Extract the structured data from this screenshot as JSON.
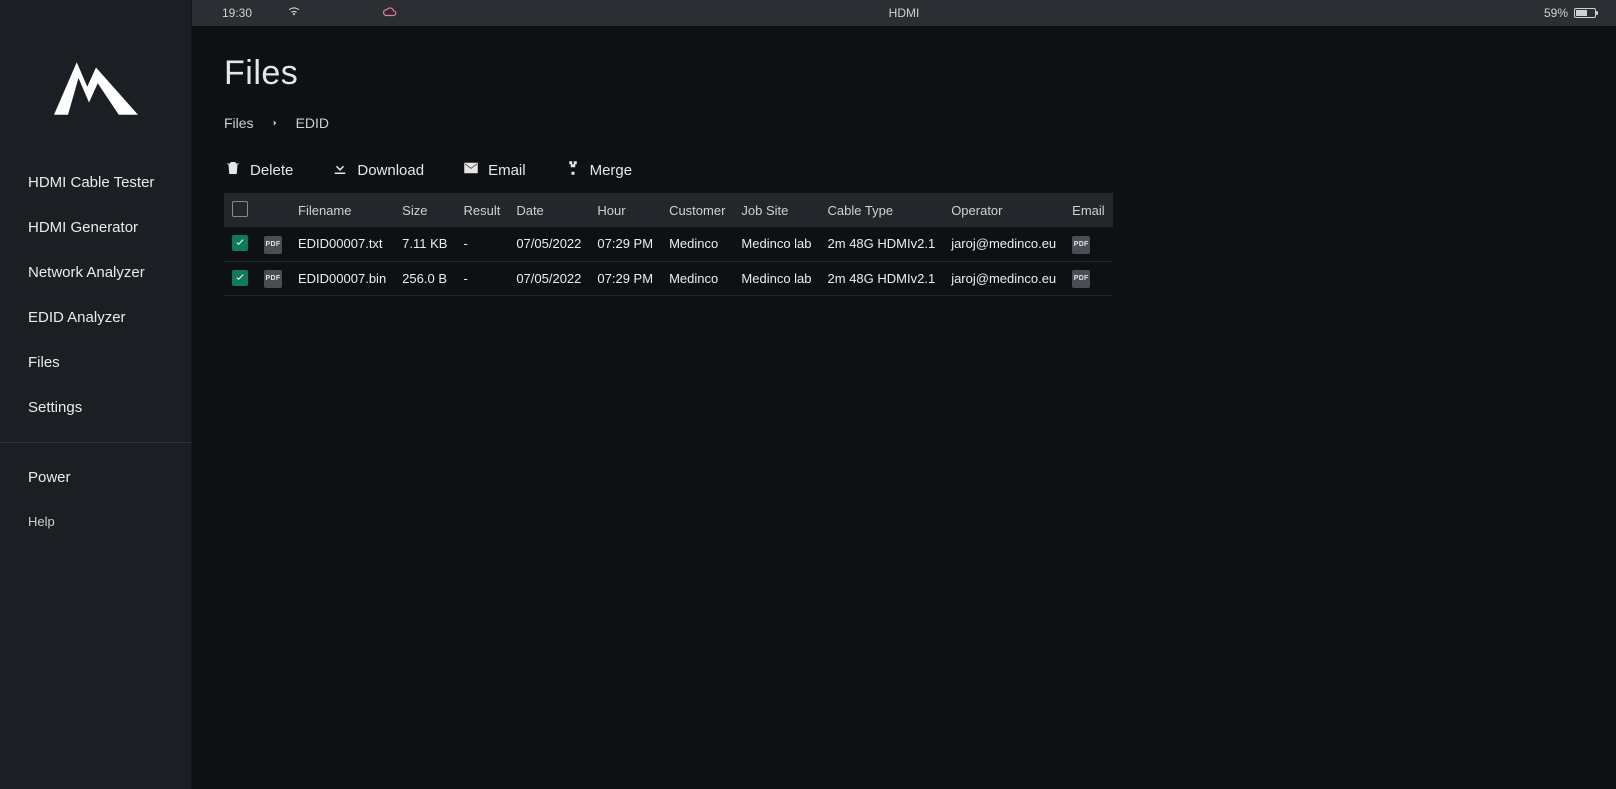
{
  "statusbar": {
    "time": "19:30",
    "center": "HDMI",
    "battery_pct": "59%"
  },
  "sidebar": {
    "items": [
      {
        "label": "HDMI Cable Tester"
      },
      {
        "label": "HDMI Generator"
      },
      {
        "label": "Network Analyzer"
      },
      {
        "label": "EDID Analyzer"
      },
      {
        "label": "Files"
      },
      {
        "label": "Settings"
      }
    ],
    "footer_items": [
      {
        "label": "Power"
      },
      {
        "label": "Help"
      }
    ]
  },
  "page": {
    "title": "Files",
    "crumbs": [
      "Files",
      "EDID"
    ]
  },
  "actions": {
    "delete": "Delete",
    "download": "Download",
    "email": "Email",
    "merge": "Merge"
  },
  "table": {
    "columns": {
      "filename": "Filename",
      "size": "Size",
      "result": "Result",
      "date": "Date",
      "hour": "Hour",
      "customer": "Customer",
      "jobsite": "Job Site",
      "cabletype": "Cable Type",
      "operator": "Operator",
      "email": "Email"
    },
    "rows": [
      {
        "checked": true,
        "filename": "EDID00007.txt",
        "size": "7.11 KB",
        "result": "-",
        "date": "07/05/2022",
        "hour": "07:29 PM",
        "customer": "Medinco",
        "jobsite": "Medinco lab",
        "cabletype": "2m 48G HDMIv2.1",
        "operator": "jaroj@medinco.eu"
      },
      {
        "checked": true,
        "filename": "EDID00007.bin",
        "size": "256.0 B",
        "result": "-",
        "date": "07/05/2022",
        "hour": "07:29 PM",
        "customer": "Medinco",
        "jobsite": "Medinco lab",
        "cabletype": "2m 48G HDMIv2.1",
        "operator": "jaroj@medinco.eu"
      }
    ]
  }
}
